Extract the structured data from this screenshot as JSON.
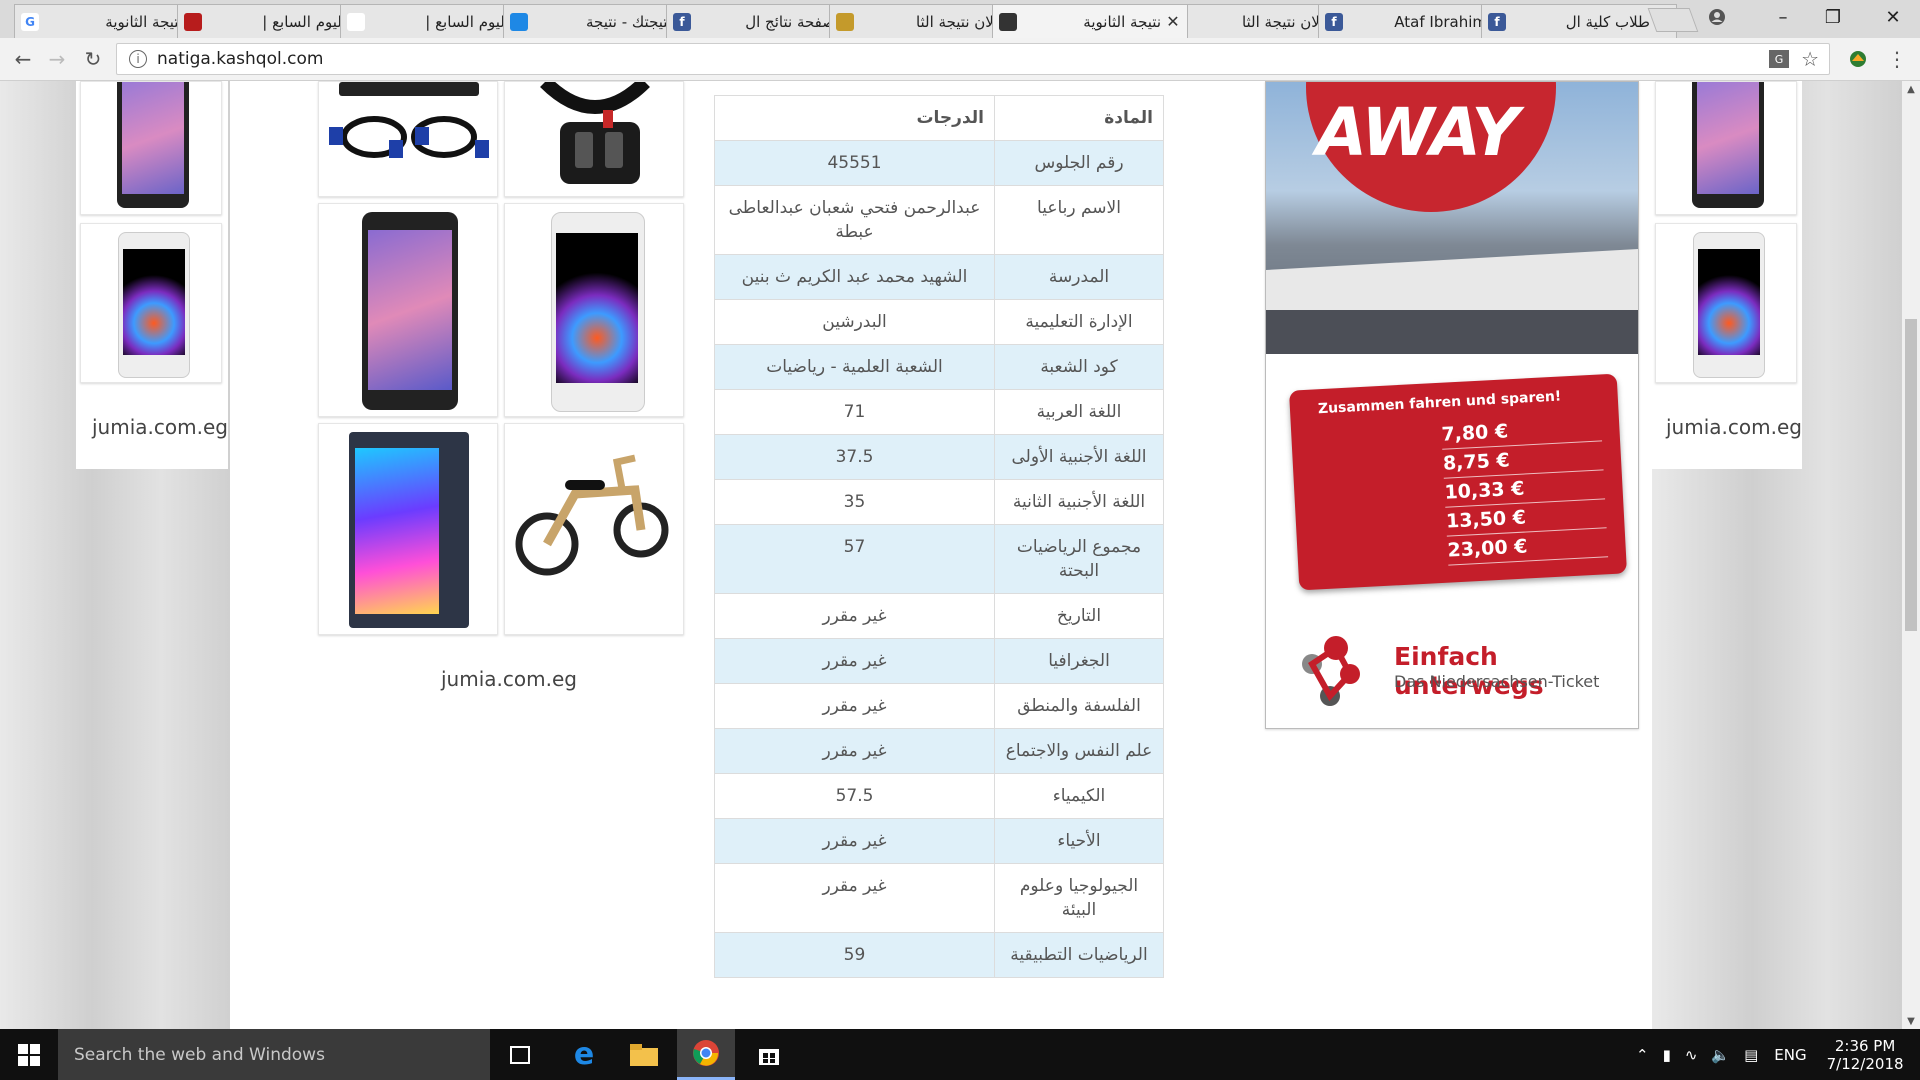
{
  "browser": {
    "tabs": [
      {
        "title": "نتيجة الثانوية",
        "favicon": "google-icon",
        "favicon_color": "#ffffff"
      },
      {
        "title": "اليوم السابع |",
        "favicon": "youm7-icon",
        "favicon_color": "#b71c1c"
      },
      {
        "title": "اليوم السابع |",
        "favicon": "page-icon",
        "favicon_color": "#ffffff"
      },
      {
        "title": "نتيجتك - نتيجة",
        "favicon": "globe-icon",
        "favicon_color": "#1e88e5"
      },
      {
        "title": "صفحة نتائج ال",
        "favicon": "facebook-icon",
        "favicon_color": "#3b5998"
      },
      {
        "title": "الان نتيجة الثا",
        "favicon": "site-icon",
        "favicon_color": "#c49a2b"
      },
      {
        "title": "نتيجة الثانوية",
        "favicon": "site-icon",
        "favicon_color": "#333333"
      },
      {
        "title": "الان نتيجة الثا",
        "favicon": "site-icon",
        "favicon_color": "#c49a2b"
      },
      {
        "title": "Ataf Ibrahim",
        "favicon": "facebook-icon",
        "favicon_color": "#3b5998"
      },
      {
        "title": "طلاب كلية ال",
        "favicon": "facebook-icon",
        "favicon_color": "#3b5998"
      }
    ],
    "active_tab_index": 6,
    "address": "natiga.kashqol.com"
  },
  "ads": {
    "left_label": "jumia.com.eg",
    "middle_label": "jumia.com.eg",
    "right_label": "jumia.com.eg",
    "banner": {
      "headline": "AWAY",
      "ticket_title": "Zusammen fahren und sparen!",
      "prices": [
        "7,80 €",
        "8,75 €",
        "10,33 €",
        "13,50 €",
        "23,00 €"
      ],
      "brand": "Einfach unterwegs",
      "brand_sub": "Das Niedersachsen-Ticket"
    }
  },
  "results": {
    "header_subject": "المادة",
    "header_grade": "الدرجات",
    "rows": [
      {
        "subject": "رقم الجلوس",
        "value": "45551"
      },
      {
        "subject": "الاسم رباعيا",
        "value": "عبدالرحمن فتحي شعبان عبدالعاطى عبطة"
      },
      {
        "subject": "المدرسة",
        "value": "الشهيد محمد عبد الكريم ث بنين"
      },
      {
        "subject": "الإدارة التعليمية",
        "value": "البدرشين"
      },
      {
        "subject": "كود الشعبة",
        "value": "الشعبة العلمية - رياضيات"
      },
      {
        "subject": "اللغة العربية",
        "value": "71"
      },
      {
        "subject": "اللغة الأجنبية الأولى",
        "value": "37.5"
      },
      {
        "subject": "اللغة الأجنبية الثانية",
        "value": "35"
      },
      {
        "subject": "مجموع الرياضيات البحتة",
        "value": "57"
      },
      {
        "subject": "التاريخ",
        "value": "غير مقرر"
      },
      {
        "subject": "الجغرافيا",
        "value": "غير مقرر"
      },
      {
        "subject": "الفلسفة والمنطق",
        "value": "غير مقرر"
      },
      {
        "subject": "علم النفس والاجتماع",
        "value": "غير مقرر"
      },
      {
        "subject": "الكيمياء",
        "value": "57.5"
      },
      {
        "subject": "الأحياء",
        "value": "غير مقرر"
      },
      {
        "subject": "الجيولوجيا وعلوم البيئة",
        "value": "غير مقرر"
      },
      {
        "subject": "الرياضيات التطبيقية",
        "value": "59"
      }
    ]
  },
  "taskbar": {
    "search_placeholder": "Search the web and Windows",
    "language": "ENG",
    "time": "2:36 PM",
    "date": "7/12/2018"
  }
}
